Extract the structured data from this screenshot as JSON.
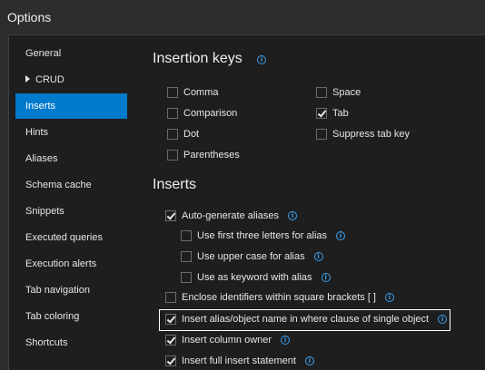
{
  "window": {
    "title": "Options"
  },
  "sidebar": {
    "items": [
      {
        "label": "General"
      },
      {
        "label": "CRUD",
        "expandable": true
      },
      {
        "label": "Inserts",
        "selected": true
      },
      {
        "label": "Hints"
      },
      {
        "label": "Aliases"
      },
      {
        "label": "Schema cache"
      },
      {
        "label": "Snippets"
      },
      {
        "label": "Executed queries"
      },
      {
        "label": "Execution alerts"
      },
      {
        "label": "Tab navigation"
      },
      {
        "label": "Tab coloring"
      },
      {
        "label": "Shortcuts"
      }
    ]
  },
  "insertion_keys": {
    "heading": "Insertion keys",
    "options": [
      {
        "label": "Comma",
        "checked": false
      },
      {
        "label": "Comparison",
        "checked": false
      },
      {
        "label": "Dot",
        "checked": false
      },
      {
        "label": "Parentheses",
        "checked": false
      },
      {
        "label": "Space",
        "checked": false
      },
      {
        "label": "Tab",
        "checked": true
      },
      {
        "label": "Suppress tab key",
        "checked": false
      }
    ]
  },
  "inserts": {
    "heading": "Inserts",
    "options": [
      {
        "label": "Auto-generate aliases",
        "checked": true
      },
      {
        "label": "Use first three letters for alias",
        "checked": false
      },
      {
        "label": "Use upper case for alias",
        "checked": false
      },
      {
        "label": "Use as keyword with alias",
        "checked": false
      },
      {
        "label": "Enclose identifiers within square brackets [ ]",
        "checked": false
      },
      {
        "label": "Insert alias/object name in where clause of single object",
        "checked": true
      },
      {
        "label": "Insert column owner",
        "checked": true
      },
      {
        "label": "Insert full insert statement",
        "checked": true
      }
    ]
  },
  "icons": {
    "info": "i"
  },
  "colors": {
    "accent": "#007acc",
    "info": "#3ba0ef"
  }
}
